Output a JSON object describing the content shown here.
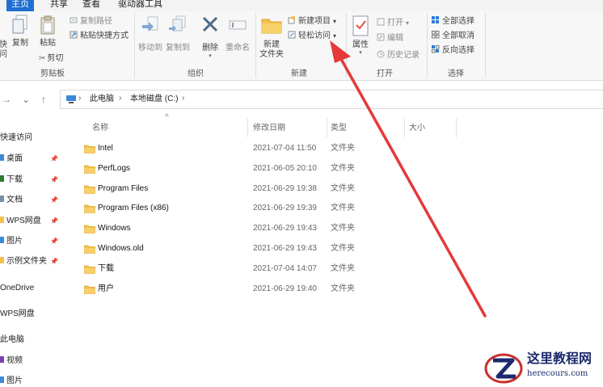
{
  "tabs": [
    {
      "label": "主页",
      "active": true
    },
    {
      "label": "共享",
      "active": false
    },
    {
      "label": "查看",
      "active": false
    },
    {
      "label": "驱动器工具",
      "active": false
    }
  ],
  "ribbon": {
    "clipboard": {
      "pin_label": "快",
      "pin_label2": "问",
      "copy_label": "复制",
      "paste_label": "粘贴",
      "copy_path_label": "复制路径",
      "paste_shortcut_label": "粘贴快捷方式",
      "cut_label": "剪切",
      "group_label": "剪贴板"
    },
    "organize": {
      "move_to_label": "移动到",
      "copy_to_label": "复制到",
      "delete_label": "删除",
      "rename_label": "重命名",
      "group_label": "组织"
    },
    "new": {
      "new_folder_label1": "新建",
      "new_folder_label2": "文件夹",
      "new_item_label": "新建项目",
      "easy_access_label": "轻松访问",
      "group_label": "新建"
    },
    "open": {
      "properties_label": "属性",
      "open_label": "打开",
      "edit_label": "编辑",
      "history_label": "历史记录",
      "group_label": "打开"
    },
    "select": {
      "select_all_label": "全部选择",
      "select_none_label": "全部取消",
      "invert_label": "反向选择",
      "group_label": "选择"
    }
  },
  "nav": {
    "forward": "→",
    "recent": "⌄",
    "up": "↑"
  },
  "address": {
    "crumbs": [
      "此电脑",
      "本地磁盘 (C:)"
    ],
    "separator": "›"
  },
  "sidebar": {
    "items": [
      {
        "label": "快速访问",
        "icon": "star-icon",
        "pinned": false
      },
      {
        "label": "桌面",
        "icon": "desktop-icon",
        "pinned": true
      },
      {
        "label": "下载",
        "icon": "download-icon",
        "pinned": true
      },
      {
        "label": "文档",
        "icon": "document-icon",
        "pinned": true
      },
      {
        "label": "WPS网盘",
        "icon": "folder-icon",
        "pinned": true
      },
      {
        "label": "图片",
        "icon": "picture-icon",
        "pinned": true
      },
      {
        "label": "示例文件夹",
        "icon": "folder-icon",
        "pinned": true
      },
      {
        "label": "OneDrive",
        "icon": "cloud-icon",
        "pinned": false
      },
      {
        "label": "WPS网盘",
        "icon": "cloud-icon",
        "pinned": false
      },
      {
        "label": "此电脑",
        "icon": "computer-icon",
        "pinned": false
      },
      {
        "label": "视频",
        "icon": "video-icon",
        "pinned": false
      },
      {
        "label": "图片",
        "icon": "picture-icon",
        "pinned": false
      }
    ],
    "pin_glyph": "📌"
  },
  "columns": {
    "name": "名称",
    "date": "修改日期",
    "type": "类型",
    "size": "大小",
    "sort_glyph": "^"
  },
  "files": [
    {
      "name": "Intel",
      "date": "2021-07-04 11:50",
      "type": "文件夹"
    },
    {
      "name": "PerfLogs",
      "date": "2021-06-05 20:10",
      "type": "文件夹"
    },
    {
      "name": "Program Files",
      "date": "2021-06-29 19:38",
      "type": "文件夹"
    },
    {
      "name": "Program Files (x86)",
      "date": "2021-06-29 19:39",
      "type": "文件夹"
    },
    {
      "name": "Windows",
      "date": "2021-06-29 19:43",
      "type": "文件夹"
    },
    {
      "name": "Windows.old",
      "date": "2021-06-29 19:43",
      "type": "文件夹"
    },
    {
      "name": "下载",
      "date": "2021-07-04 14:07",
      "type": "文件夹"
    },
    {
      "name": "用户",
      "date": "2021-06-29 19:40",
      "type": "文件夹"
    }
  ],
  "watermark": {
    "title": "这里教程网",
    "url": "herecours.com"
  },
  "colors": {
    "accent": "#1f6fd1",
    "folder": "#f2c14e",
    "arrow": "#e5393a",
    "watermark": "#1b2a6b"
  }
}
